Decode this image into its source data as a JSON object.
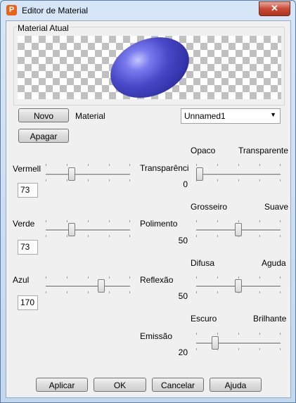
{
  "window": {
    "title": "Editor de Material",
    "close_label": "✕",
    "app_icon_letter": "P"
  },
  "preview": {
    "group_label": "Material Atual",
    "material_color": "#4848c8"
  },
  "buttons": {
    "new": "Novo",
    "delete": "Apagar",
    "apply": "Aplicar",
    "ok": "OK",
    "cancel": "Cancelar",
    "help": "Ajuda"
  },
  "material": {
    "label": "Material",
    "selected": "Unnamed1"
  },
  "left_sliders": [
    {
      "label": "Vermell",
      "value": "73"
    },
    {
      "label": "Verde",
      "value": "73"
    },
    {
      "label": "Azul",
      "value": "170"
    }
  ],
  "right_sliders": [
    {
      "label": "Transparênci",
      "min_label": "Opaco",
      "max_label": "Transparente",
      "value": "0"
    },
    {
      "label": "Polimento",
      "min_label": "Grosseiro",
      "max_label": "Suave",
      "value": "50"
    },
    {
      "label": "Reflexão",
      "min_label": "Difusa",
      "max_label": "Aguda",
      "value": "50"
    },
    {
      "label": "Emissão",
      "min_label": "Escuro",
      "max_label": "Brilhante",
      "value": "20"
    }
  ]
}
